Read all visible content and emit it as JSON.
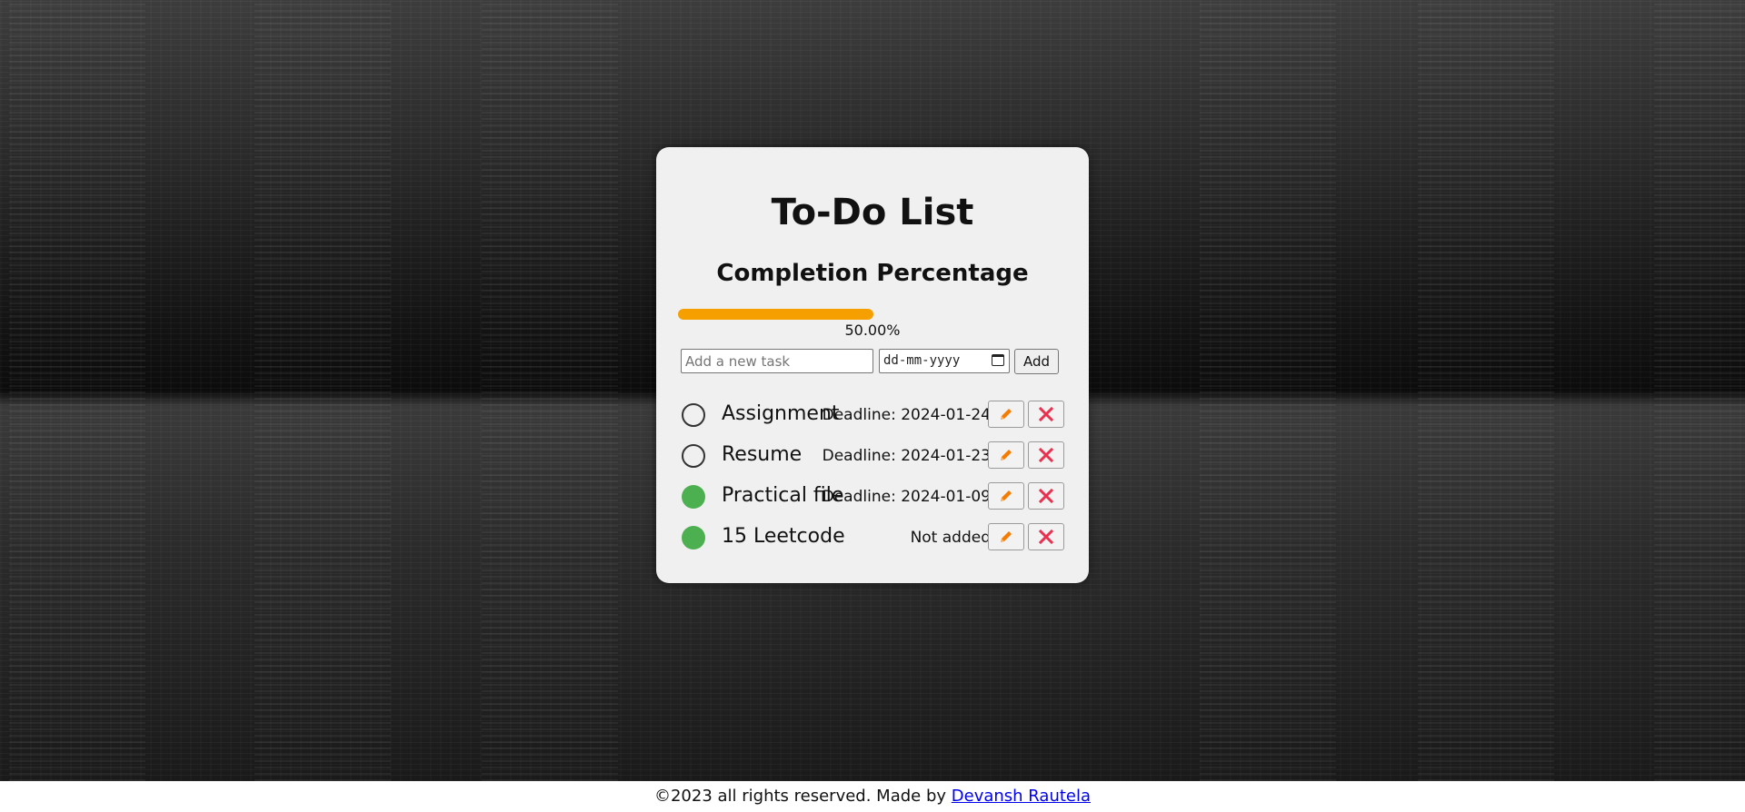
{
  "app": {
    "title": "To-Do List",
    "subtitle": "Completion Percentage"
  },
  "progress": {
    "fraction": 0.5,
    "label": "50.00%",
    "color": "#f5a000"
  },
  "form": {
    "task_placeholder": "Add a new task",
    "task_value": "",
    "date_placeholder": "dd-mm-yyyy",
    "add_label": "Add"
  },
  "tasks": [
    {
      "name": "Assignment",
      "deadline": "Deadline: 2024-01-24",
      "completed": false
    },
    {
      "name": "Resume",
      "deadline": "Deadline: 2024-01-23",
      "completed": false
    },
    {
      "name": "Practical file",
      "deadline": "Deadline: 2024-01-09",
      "completed": true
    },
    {
      "name": "15 Leetcode",
      "deadline": "Not added",
      "completed": true
    }
  ],
  "icons": {
    "edit": "pencil-icon",
    "delete": "close-icon",
    "edit_color": "#f57c00",
    "delete_color": "#e8304f",
    "done_color": "#4caf50"
  },
  "footer": {
    "text": "©2023 all rights reserved. Made by ",
    "author_link": "Devansh Rautela"
  }
}
